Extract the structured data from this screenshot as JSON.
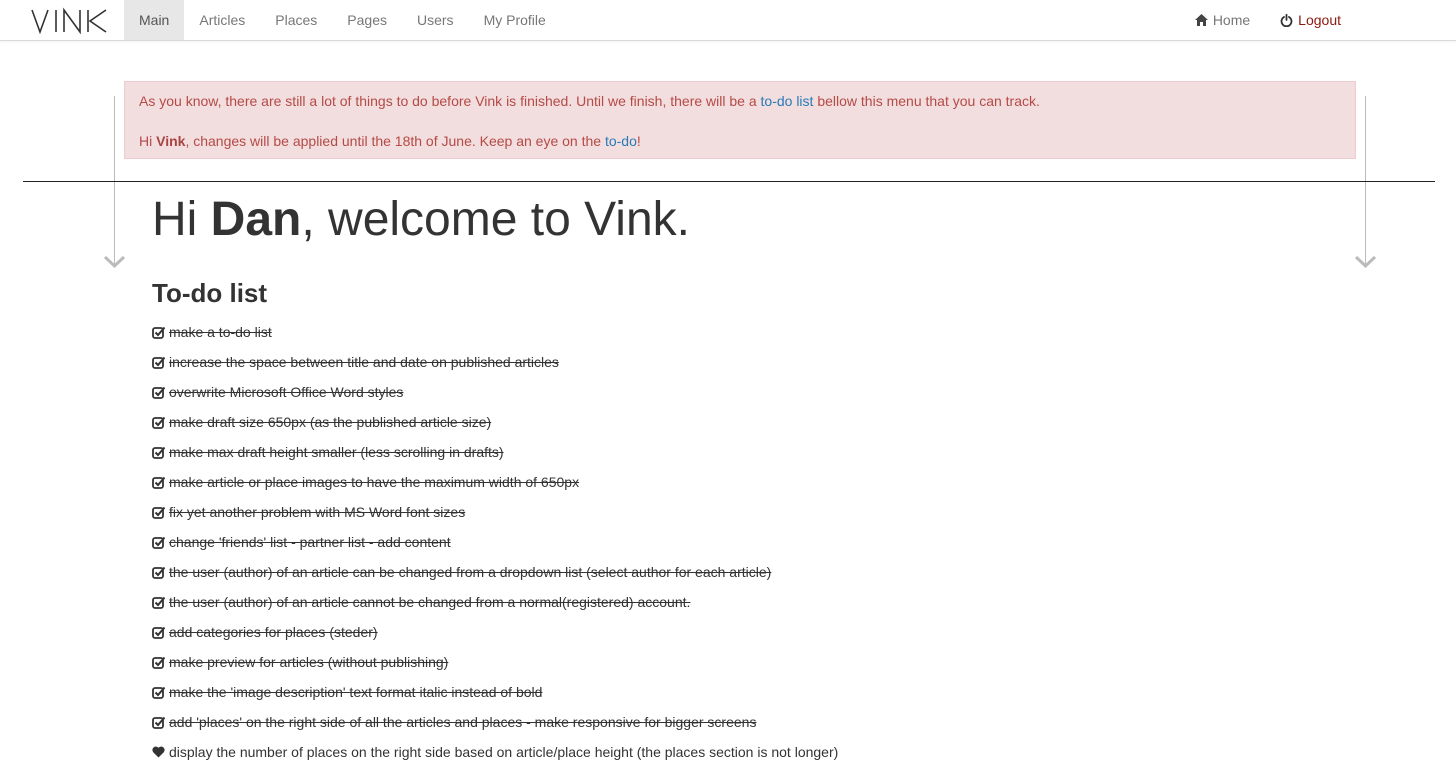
{
  "brand": {
    "logo_text": "VINK"
  },
  "nav": {
    "items": [
      {
        "label": "Main",
        "active": true
      },
      {
        "label": "Articles"
      },
      {
        "label": "Places"
      },
      {
        "label": "Pages"
      },
      {
        "label": "Users"
      },
      {
        "label": "My Profile"
      }
    ],
    "home_label": "Home",
    "logout_label": "Logout"
  },
  "alert": {
    "l1_before": "As you know, there are still a lot of things to do before Vink is finished. Until we finish, there will be a ",
    "l1_link": "to-do list",
    "l1_after": " bellow this menu that you can track.",
    "l2_hi": "Hi ",
    "l2_name": "Vink",
    "l2_middle": ", changes will be applied until the 18th of June. Keep an eye on the ",
    "l2_link": "to-do",
    "l2_end": "!"
  },
  "welcome": {
    "hi": "Hi ",
    "name": "Dan",
    "rest": ", welcome to Vink."
  },
  "todo": {
    "title": "To-do list",
    "items": [
      {
        "text": " make a to-do list",
        "done": true
      },
      {
        "text": " increase the space between title and date on published articles",
        "done": true
      },
      {
        "text": " overwrite Microsoft Office Word styles",
        "done": true
      },
      {
        "text": " make draft size 650px (as the published article size)",
        "done": true
      },
      {
        "text": " make max draft height smaller (less scrolling in drafts)",
        "done": true
      },
      {
        "text": " make article or place images to have the maximum width of 650px",
        "done": true
      },
      {
        "text": " fix yet another problem with MS Word font sizes",
        "done": true
      },
      {
        "text": " change 'friends' list - partner list - add content",
        "done": true
      },
      {
        "text": " the user (author) of an article can be changed from a dropdown list (select author for each article)",
        "done": true
      },
      {
        "text": " the user (author) of an article cannot be changed from a normal(registered) account.",
        "done": true
      },
      {
        "text": " add categories for places (steder)",
        "done": true
      },
      {
        "text": " make preview for articles (without publishing)",
        "done": true
      },
      {
        "text": " make the 'image description' text format italic instead of bold",
        "done": true
      },
      {
        "text": " add 'places' on the right side of all the articles and places - make responsive for bigger screens",
        "done": true
      },
      {
        "text": " display the number of places on the right side based on article/place height (the places section is not longer)",
        "done": false
      }
    ]
  }
}
